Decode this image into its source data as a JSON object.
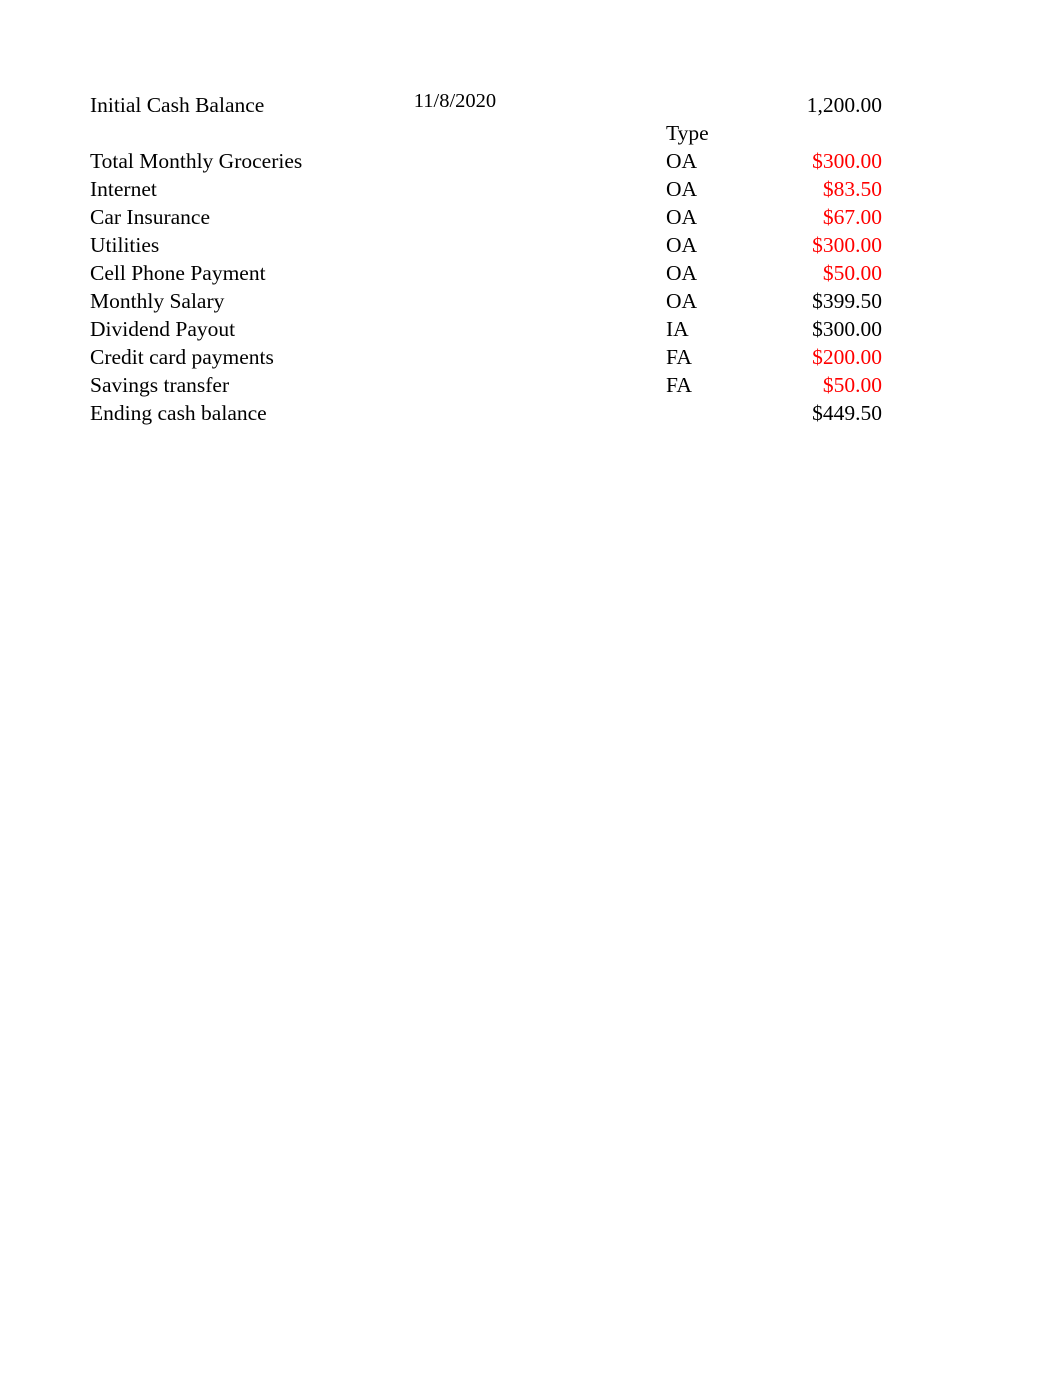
{
  "document": {
    "type": "spreadsheet-cash-flow-budget",
    "column_headers": {
      "type_header": "Type"
    },
    "opening": {
      "label": "Initial Cash Balance",
      "date": "11/8/2020",
      "amount": "1,200.00",
      "amount_color": "#000000"
    },
    "rows": [
      {
        "label": "Total Monthly Groceries",
        "type": "OA",
        "amount": "$300.00",
        "negative": true
      },
      {
        "label": "Internet",
        "type": "OA",
        "amount": "$83.50",
        "negative": true
      },
      {
        "label": "Car Insurance",
        "type": "OA",
        "amount": "$67.00",
        "negative": true
      },
      {
        "label": "Utilities",
        "type": "OA",
        "amount": "$300.00",
        "negative": true
      },
      {
        "label": "Cell Phone Payment",
        "type": "OA",
        "amount": "$50.00",
        "negative": true
      },
      {
        "label": "Monthly Salary",
        "type": "OA",
        "amount": "$399.50",
        "negative": false
      },
      {
        "label": "Dividend Payout",
        "type": "IA",
        "amount": "$300.00",
        "negative": false
      },
      {
        "label": "Credit card payments",
        "type": "FA",
        "amount": "$200.00",
        "negative": true
      },
      {
        "label": "Savings transfer",
        "type": "FA",
        "amount": "$50.00",
        "negative": true
      }
    ],
    "total": {
      "label": "Ending cash balance",
      "type": "",
      "amount": "$449.50",
      "negative": false
    },
    "colors": {
      "negative": "#FF0000",
      "positive": "#000000",
      "page_background": "#FFFFFF"
    }
  }
}
